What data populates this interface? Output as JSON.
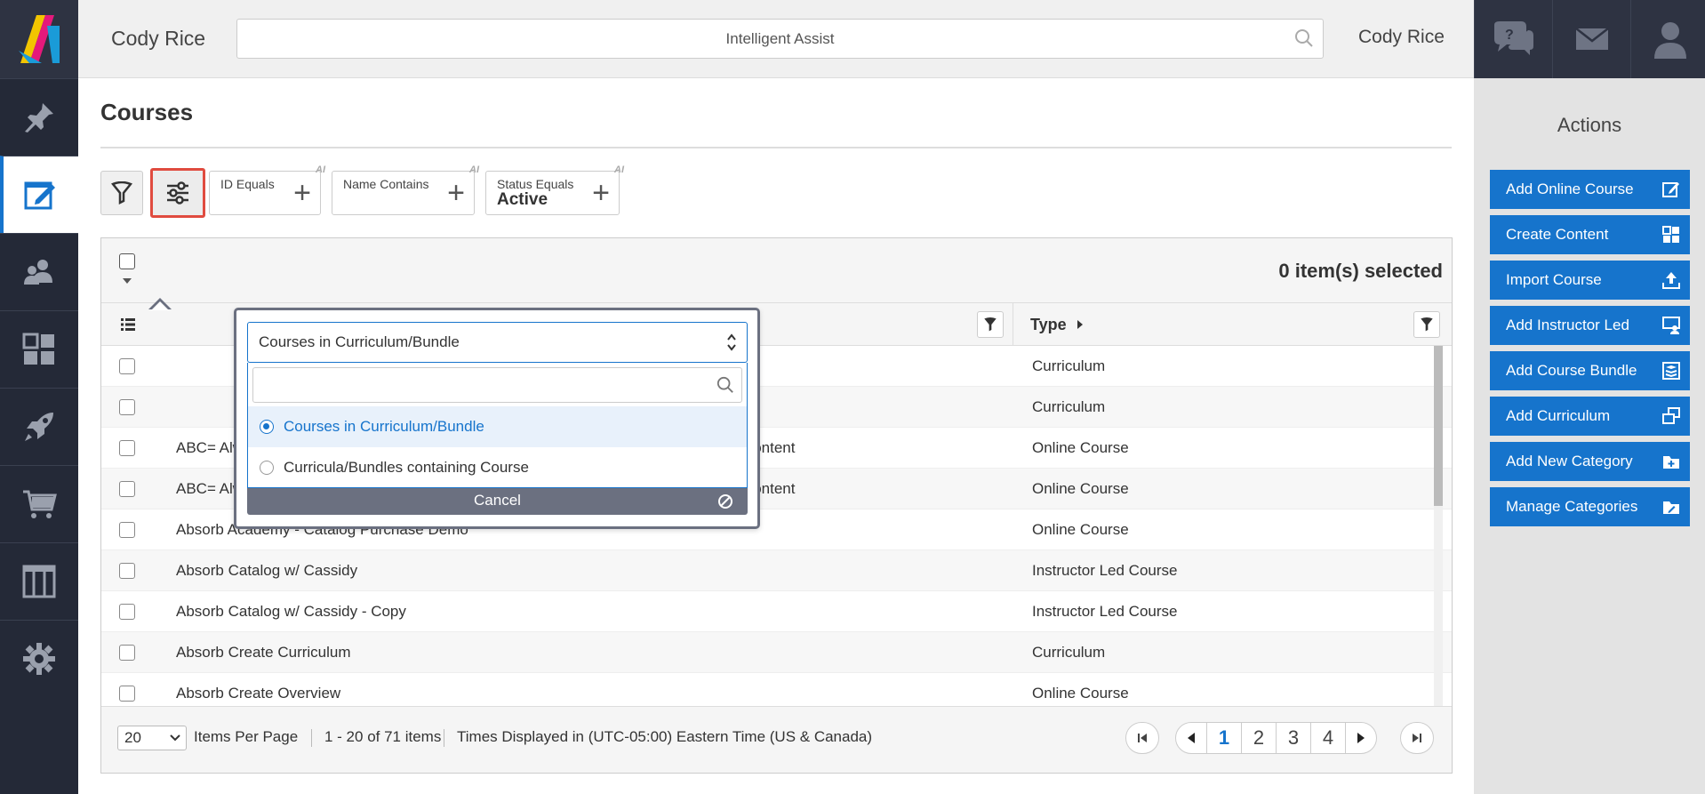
{
  "header": {
    "user_name_left": "Cody Rice",
    "search_placeholder": "Intelligent Assist",
    "user_name_right": "Cody Rice"
  },
  "page": {
    "title": "Courses"
  },
  "filters": {
    "chips": [
      {
        "label": "ID Equals",
        "value": ""
      },
      {
        "label": "Name Contains",
        "value": ""
      },
      {
        "label": "Status Equals",
        "value": "Active"
      }
    ]
  },
  "grid": {
    "selected_count": "0 item(s) selected",
    "columns": {
      "type": "Type"
    },
    "rows": [
      {
        "name": "",
        "category": "",
        "type": "Curriculum"
      },
      {
        "name": "",
        "category": "",
        "type": "Curriculum"
      },
      {
        "name": "ABC= Always Be Closing",
        "category": "Absorb Amplify Trial Content",
        "type": "Online Course"
      },
      {
        "name": "ABC= Always Be Closing - Copy",
        "category": "Absorb Amplify Trial Content",
        "type": "Online Course"
      },
      {
        "name": "Absorb Academy - Catalog Purchase Demo",
        "category": "",
        "type": "Online Course"
      },
      {
        "name": "Absorb Catalog w/ Cassidy",
        "category": "",
        "type": "Instructor Led Course"
      },
      {
        "name": "Absorb Catalog w/ Cassidy - Copy",
        "category": "",
        "type": "Instructor Led Course"
      },
      {
        "name": "Absorb Create Curriculum",
        "category": "",
        "type": "Curriculum"
      },
      {
        "name": "Absorb Create Overview",
        "category": "",
        "type": "Online Course"
      }
    ],
    "footer": {
      "per_page": "20",
      "per_page_label": "Items Per Page",
      "range": "1 - 20 of 71 items",
      "timezone": "Times Displayed in (UTC-05:00) Eastern Time (US & Canada)",
      "pages": [
        "1",
        "2",
        "3",
        "4"
      ],
      "current_page": "1"
    }
  },
  "popover": {
    "selected": "Courses in Curriculum/Bundle",
    "options": [
      {
        "label": "Courses in Curriculum/Bundle",
        "selected": true
      },
      {
        "label": "Curricula/Bundles containing Course",
        "selected": false
      }
    ],
    "cancel_label": "Cancel"
  },
  "actions": {
    "title": "Actions",
    "buttons": [
      {
        "label": "Add Online Course",
        "icon": "edit-icon"
      },
      {
        "label": "Create Content",
        "icon": "grid-icon"
      },
      {
        "label": "Import Course",
        "icon": "upload-icon"
      },
      {
        "label": "Add Instructor Led",
        "icon": "instructor-icon"
      },
      {
        "label": "Add Course Bundle",
        "icon": "bundle-icon"
      },
      {
        "label": "Add Curriculum",
        "icon": "curriculum-icon"
      },
      {
        "label": "Add New Category",
        "icon": "folder-plus-icon"
      },
      {
        "label": "Manage Categories",
        "icon": "folder-edit-icon"
      }
    ]
  },
  "colors": {
    "accent": "#1674cc",
    "nav_bg": "#242937",
    "highlight": "#e04b3f"
  }
}
